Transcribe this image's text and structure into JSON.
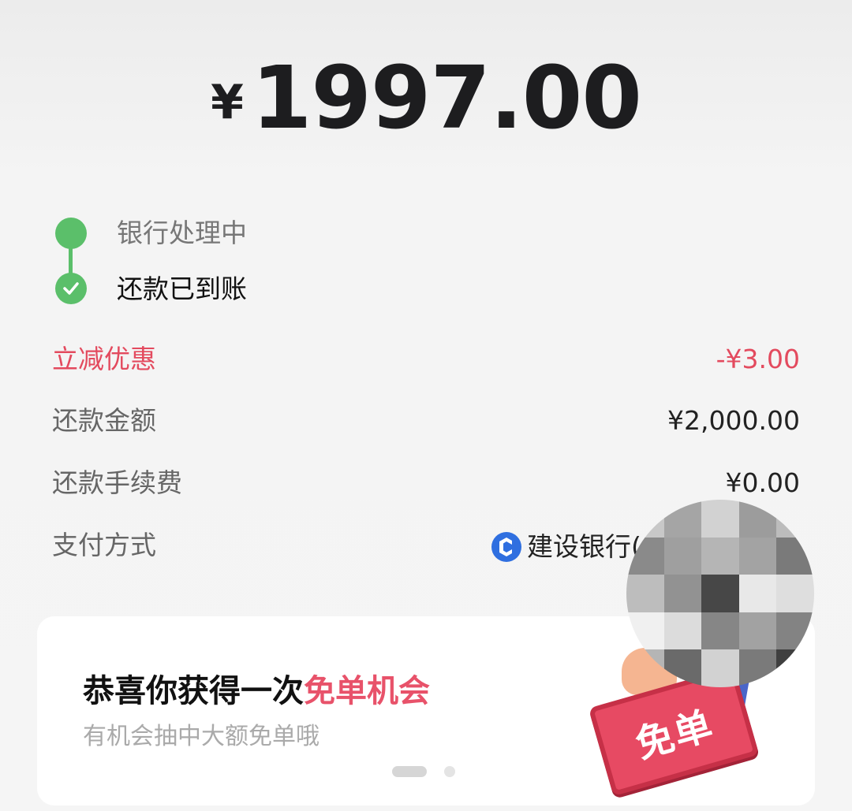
{
  "amount": {
    "currency_symbol": "¥",
    "value": "1997.00"
  },
  "timeline": {
    "step1": "银行处理中",
    "step2": "还款已到账"
  },
  "details": {
    "discount_label": "立减优惠",
    "discount_value": "-¥3.00",
    "repay_label": "还款金额",
    "repay_value": "¥2,000.00",
    "fee_label": "还款手续费",
    "fee_value": "¥0.00",
    "method_label": "支付方式",
    "method_value": "建设银行("
  },
  "promo": {
    "title_prefix": "恭喜你获得一次",
    "title_highlight": "免单机会",
    "subtitle": "有机会抽中大额免单哦",
    "badge_text": "免单",
    "page_count": 2,
    "active_page": 1
  },
  "colors": {
    "accent_green": "#5bbf6a",
    "discount_red": "#e34a5e",
    "highlight_pink": "#e8526a",
    "ccb_blue": "#2f6fe0"
  },
  "icons": {
    "bank_icon": "ccb-bank-logo-icon",
    "step_check": "check-icon"
  }
}
